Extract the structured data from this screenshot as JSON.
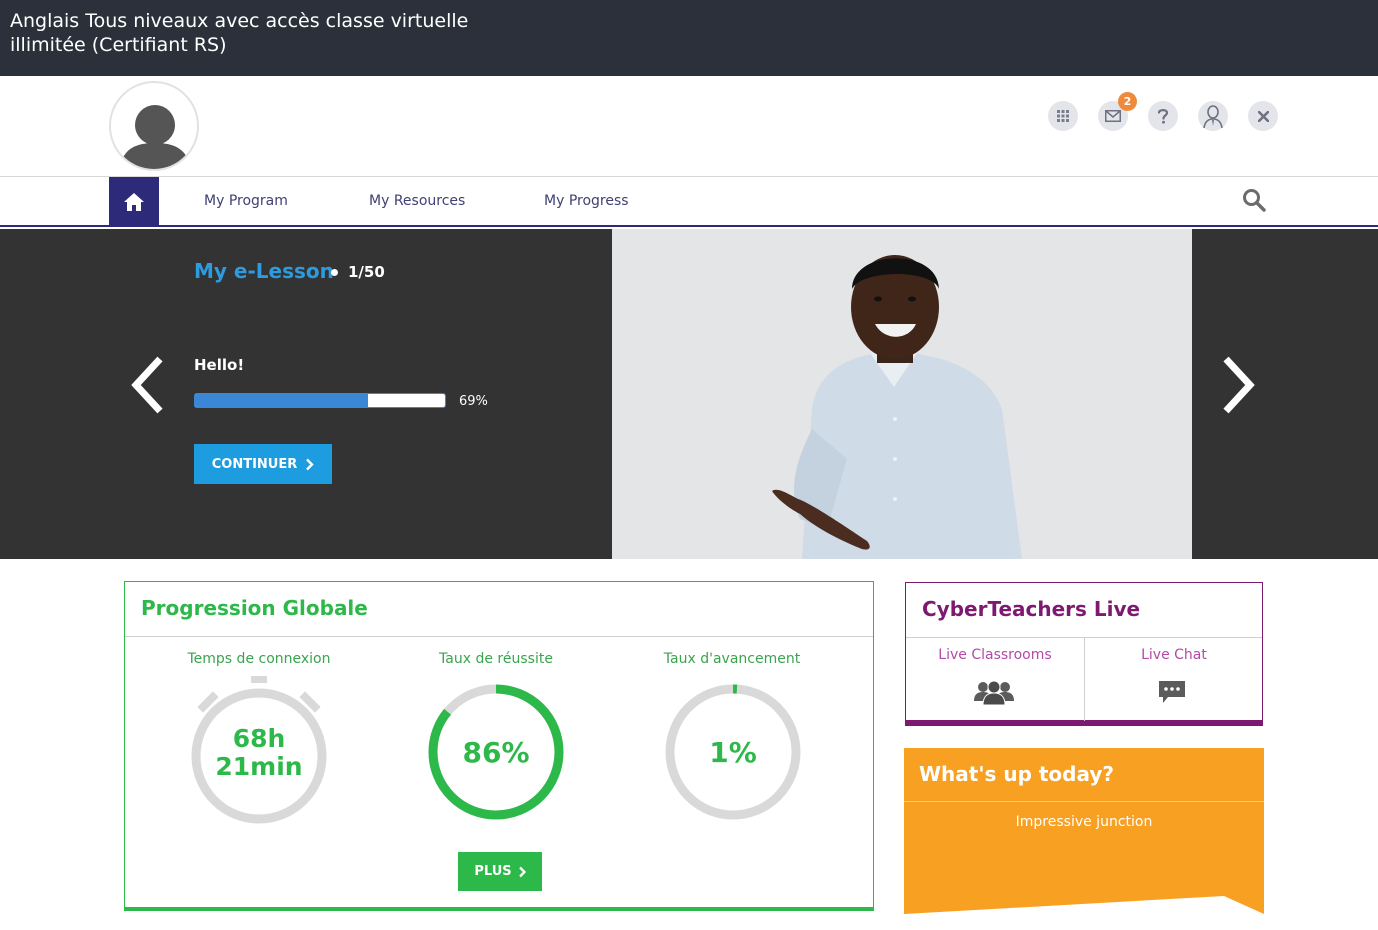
{
  "window": {
    "title": "Anglais Tous niveaux avec accès classe virtuelle illimitée (Certifiant RS)"
  },
  "header": {
    "icons": [
      "apps-grid-icon",
      "mail-icon",
      "help-icon",
      "coach-icon",
      "close-icon"
    ],
    "mail_badge": "2"
  },
  "nav": {
    "items": [
      {
        "label": "My Program"
      },
      {
        "label": "My Resources"
      },
      {
        "label": "My Progress"
      }
    ]
  },
  "hero": {
    "title": "My e-Lesson",
    "count": "1/50",
    "lesson_name": "Hello!",
    "progress": 0.69,
    "progress_label": "69%",
    "continue_label": "CONTINUER"
  },
  "progression": {
    "title": "Progression Globale",
    "stats": [
      {
        "label": "Temps de connexion",
        "value_line1": "68h",
        "value_line2": "21min"
      },
      {
        "label": "Taux de réussite",
        "value": "86%",
        "fraction": 0.86
      },
      {
        "label": "Taux d'avancement",
        "value": "1%",
        "fraction": 0.01
      }
    ],
    "more_label": "PLUS"
  },
  "cyberteachers": {
    "title": "CyberTeachers Live",
    "links": [
      {
        "label": "Live Classrooms",
        "icon": "group-icon"
      },
      {
        "label": "Live Chat",
        "icon": "chat-icon"
      }
    ]
  },
  "whats_up": {
    "title": "What's up today?",
    "text": "Impressive junction"
  },
  "colors": {
    "titlebar": "#2b303b",
    "nav_accent": "#2d2a7a",
    "hero_bg": "#333333",
    "lesson_blue": "#2d9be0",
    "green": "#2db84a",
    "purple": "#7d1a6f",
    "orange": "#f7a021"
  }
}
